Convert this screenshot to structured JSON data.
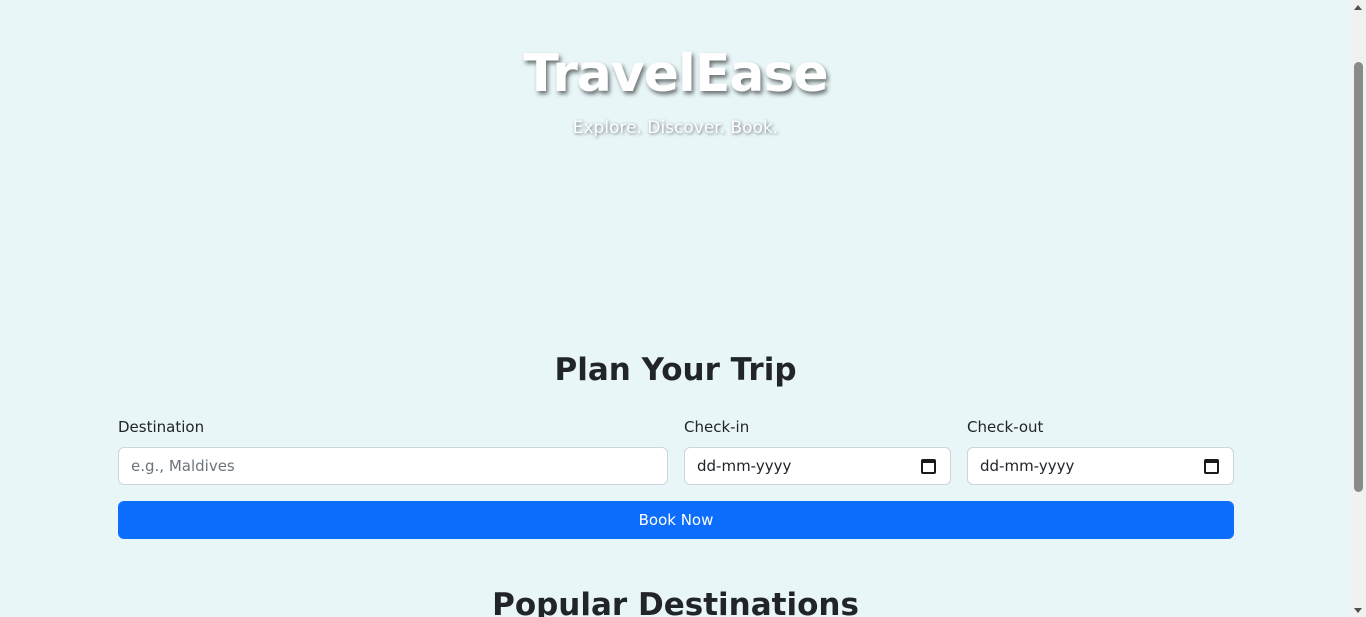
{
  "hero": {
    "brand": "TravelEase",
    "tagline": "Explore. Discover. Book."
  },
  "plan": {
    "title": "Plan Your Trip",
    "destination_label": "Destination",
    "destination_placeholder": "e.g., Maldives",
    "checkin_label": "Check-in",
    "checkin_value": "dd-mm-yyyy",
    "checkout_label": "Check-out",
    "checkout_value": "dd-mm-yyyy",
    "book_button": "Book Now"
  },
  "popular": {
    "title": "Popular Destinations"
  },
  "colors": {
    "page_background": "#e8f6f8",
    "primary": "#0d6efd",
    "text": "#212529"
  },
  "icons": {
    "checkin_icon": "calendar-icon",
    "checkout_icon": "calendar-icon"
  }
}
